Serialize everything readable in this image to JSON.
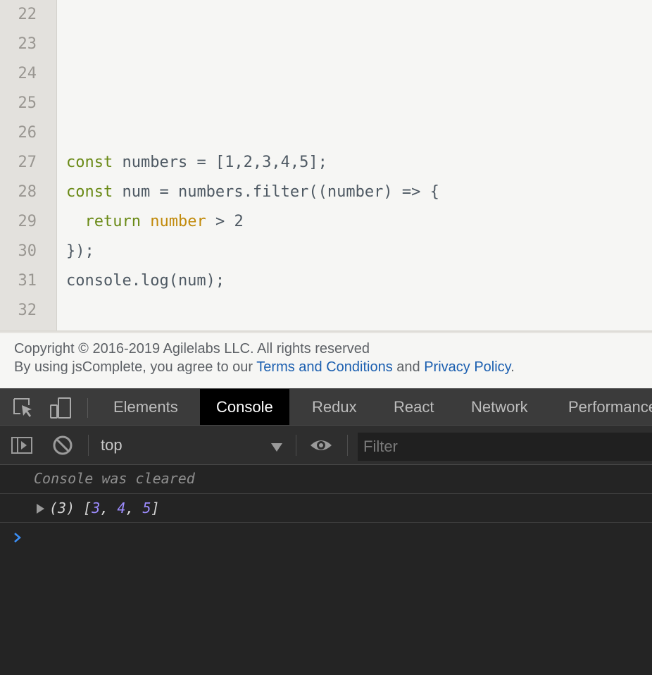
{
  "editor": {
    "lines": [
      {
        "num": "22",
        "code": ""
      },
      {
        "num": "23",
        "code": ""
      },
      {
        "num": "24",
        "code": ""
      },
      {
        "num": "25",
        "code": ""
      },
      {
        "num": "26",
        "code": ""
      },
      {
        "num": "27",
        "kw": "const",
        "rest": " numbers = [1,2,3,4,5];"
      },
      {
        "num": "28",
        "kw": "const",
        "rest": " num = numbers.filter((number) => {"
      },
      {
        "num": "29",
        "indent": "  ",
        "kw": "return",
        "param": "number",
        "rest": " > 2"
      },
      {
        "num": "30",
        "code": "});"
      },
      {
        "num": "31",
        "code": "console.log(num);"
      },
      {
        "num": "32",
        "code": ""
      }
    ]
  },
  "footer": {
    "copyright": "Copyright © 2016-2019 Agilelabs LLC. All rights reserved",
    "agree_prefix": "By using jsComplete, you agree to our ",
    "terms_link": "Terms and Conditions",
    "and_text": " and ",
    "privacy_link": "Privacy Policy",
    "period": "."
  },
  "devtools": {
    "tabs": [
      {
        "label": "Elements",
        "active": false
      },
      {
        "label": "Console",
        "active": true
      },
      {
        "label": "Redux",
        "active": false
      },
      {
        "label": "React",
        "active": false
      },
      {
        "label": "Network",
        "active": false
      },
      {
        "label": "Performance",
        "active": false
      }
    ],
    "toolbar": {
      "context": "top",
      "filter_placeholder": "Filter"
    },
    "console": {
      "cleared_message": "Console was cleared",
      "result_count": "(3) ",
      "result_open": "[",
      "values": [
        "3",
        "4",
        "5"
      ],
      "separator": ", ",
      "result_close": "]"
    },
    "icons": [
      "inspect-element-icon",
      "device-toolbar-icon",
      "sidebar-toggle-icon",
      "clear-console-icon",
      "eye-icon",
      "prompt-chevron-icon"
    ],
    "colors": {
      "accent_prompt": "#3b8ff6",
      "number_value": "#9d8cff",
      "keyword": "#6a8a16",
      "param": "#c18a0b",
      "link": "#1b5fb0"
    }
  }
}
